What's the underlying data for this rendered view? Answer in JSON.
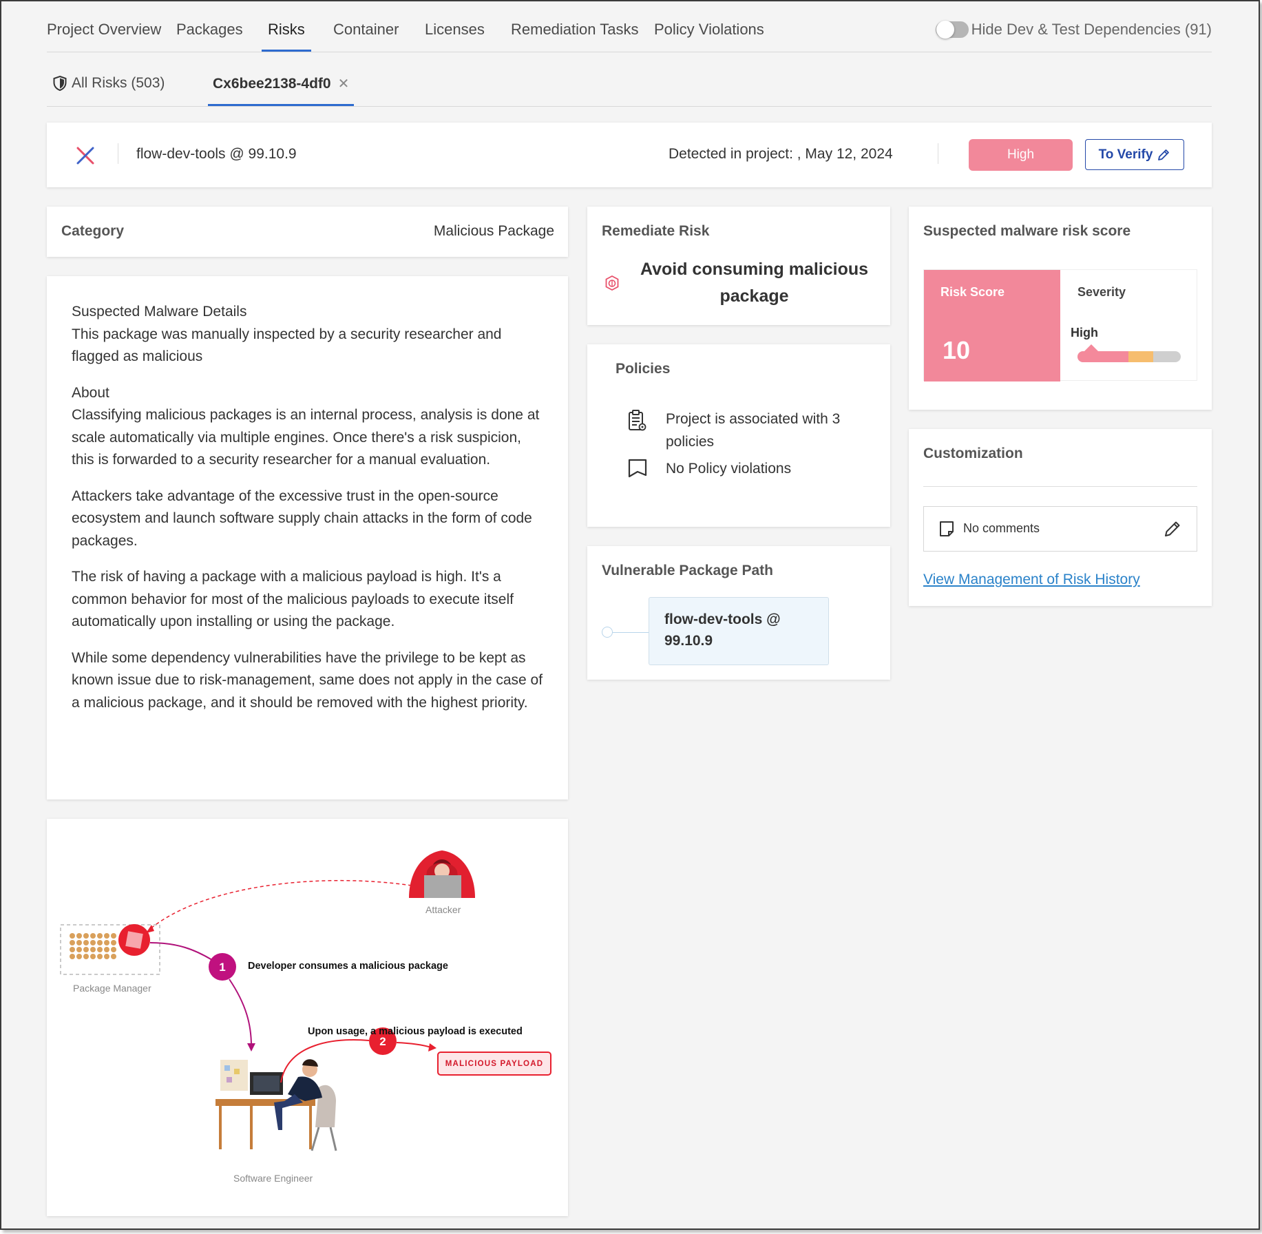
{
  "tabs": [
    {
      "label": "Project Overview",
      "active": false
    },
    {
      "label": "Packages",
      "active": false
    },
    {
      "label": "Risks",
      "active": true
    },
    {
      "label": "Container",
      "active": false
    },
    {
      "label": "Licenses",
      "active": false
    },
    {
      "label": "Remediation Tasks",
      "active": false
    },
    {
      "label": "Policy Violations",
      "active": false
    }
  ],
  "toggle": {
    "label": "Hide Dev & Test Dependencies (91)",
    "on": false
  },
  "subtabs": {
    "all_risks": "All Risks (503)",
    "current": "Cx6bee2138-4df0"
  },
  "header": {
    "package": "flow-dev-tools @ 99.10.9",
    "detected": "Detected in project: , May 12, 2024",
    "severity": "High",
    "state_button": "To Verify"
  },
  "category": {
    "label": "Category",
    "value": "Malicious Package"
  },
  "description": {
    "title": "Suspected Malware Details",
    "summary": "This package was manually inspected by a security researcher and flagged as malicious",
    "about_title": "About",
    "paragraphs": [
      "Classifying malicious packages is an internal process, analysis is done at scale automatically via multiple engines. Once there's a risk suspicion, this is forwarded to a security researcher for a manual evaluation.",
      "Attackers take advantage of the excessive trust in the open-source ecosystem and launch software supply chain attacks in the form of code packages.",
      "The risk of having a package with a malicious payload is high. It's a common behavior for most of the malicious payloads to execute itself automatically upon installing or using the package.",
      "While some dependency vulnerabilities have the privilege to be kept as known issue due to risk-management, same does not apply in the case of a malicious package, and it should be removed with the highest priority."
    ]
  },
  "illustration": {
    "attacker": "Attacker",
    "package_manager": "Package Manager",
    "engineer": "Software Engineer",
    "step1_num": "1",
    "step1": "Developer consumes a malicious package",
    "step2_num": "2",
    "step2": "Upon usage, a malicious payload is executed",
    "payload": "MALICIOUS PAYLOAD"
  },
  "remediate": {
    "title": "Remediate Risk",
    "text": "Avoid consuming malicious package",
    "icon": "bug-shield-icon"
  },
  "policies": {
    "title": "Policies",
    "associated": "Project is associated with 3 policies",
    "violations": "No Policy violations"
  },
  "path": {
    "title": "Vulnerable Package Path",
    "node": "flow-dev-tools @ 99.10.9"
  },
  "score": {
    "title": "Suspected malware risk score",
    "risk_label": "Risk Score",
    "risk_value": "10",
    "severity_label": "Severity",
    "severity_value": "High"
  },
  "customization": {
    "title": "Customization",
    "comments": "No comments",
    "history_link": "View Management of Risk History"
  },
  "colors": {
    "accent": "#2d6bcf",
    "high": "#f2889a",
    "medium": "#f6bd6e",
    "link": "#2a82c9",
    "danger": "#e8202f"
  }
}
